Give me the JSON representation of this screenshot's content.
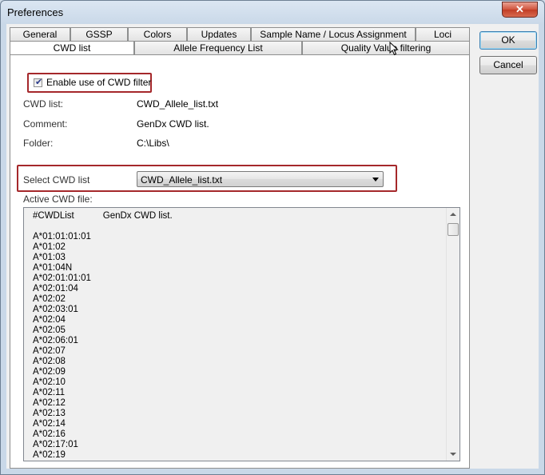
{
  "window": {
    "title": "Preferences",
    "close_glyph": "✕"
  },
  "tabs_row1": [
    "General",
    "GSSP",
    "Colors",
    "Updates",
    "Sample Name / Locus Assignment",
    "Loci"
  ],
  "tabs_row2": [
    "CWD list",
    "Allele Frequency List",
    "Quality Value filtering"
  ],
  "buttons": {
    "ok": "OK",
    "cancel": "Cancel"
  },
  "cwd": {
    "enable_label": "Enable use of CWD filter",
    "enabled": true,
    "list_label": "CWD list:",
    "list_value": "CWD_Allele_list.txt",
    "comment_label": "Comment:",
    "comment_value": "GenDx CWD list.",
    "folder_label": "Folder:",
    "folder_value": "C:\\Libs\\",
    "select_label": "Select CWD list",
    "select_value": "CWD_Allele_list.txt",
    "active_label": "Active CWD file:"
  },
  "active_file": {
    "header_key": "#CWDList",
    "header_value": "GenDx CWD list.",
    "alleles": [
      "A*01:01:01:01",
      "A*01:02",
      "A*01:03",
      "A*01:04N",
      "A*02:01:01:01",
      "A*02:01:04",
      "A*02:02",
      "A*02:03:01",
      "A*02:04",
      "A*02:05",
      "A*02:06:01",
      "A*02:07",
      "A*02:08",
      "A*02:09",
      "A*02:10",
      "A*02:11",
      "A*02:12",
      "A*02:13",
      "A*02:14",
      "A*02:16",
      "A*02:17:01",
      "A*02:19"
    ]
  },
  "colors": {
    "highlight_border": "#a5282b",
    "titlebar": "#c9d8e8",
    "close_button": "#c13d25"
  }
}
